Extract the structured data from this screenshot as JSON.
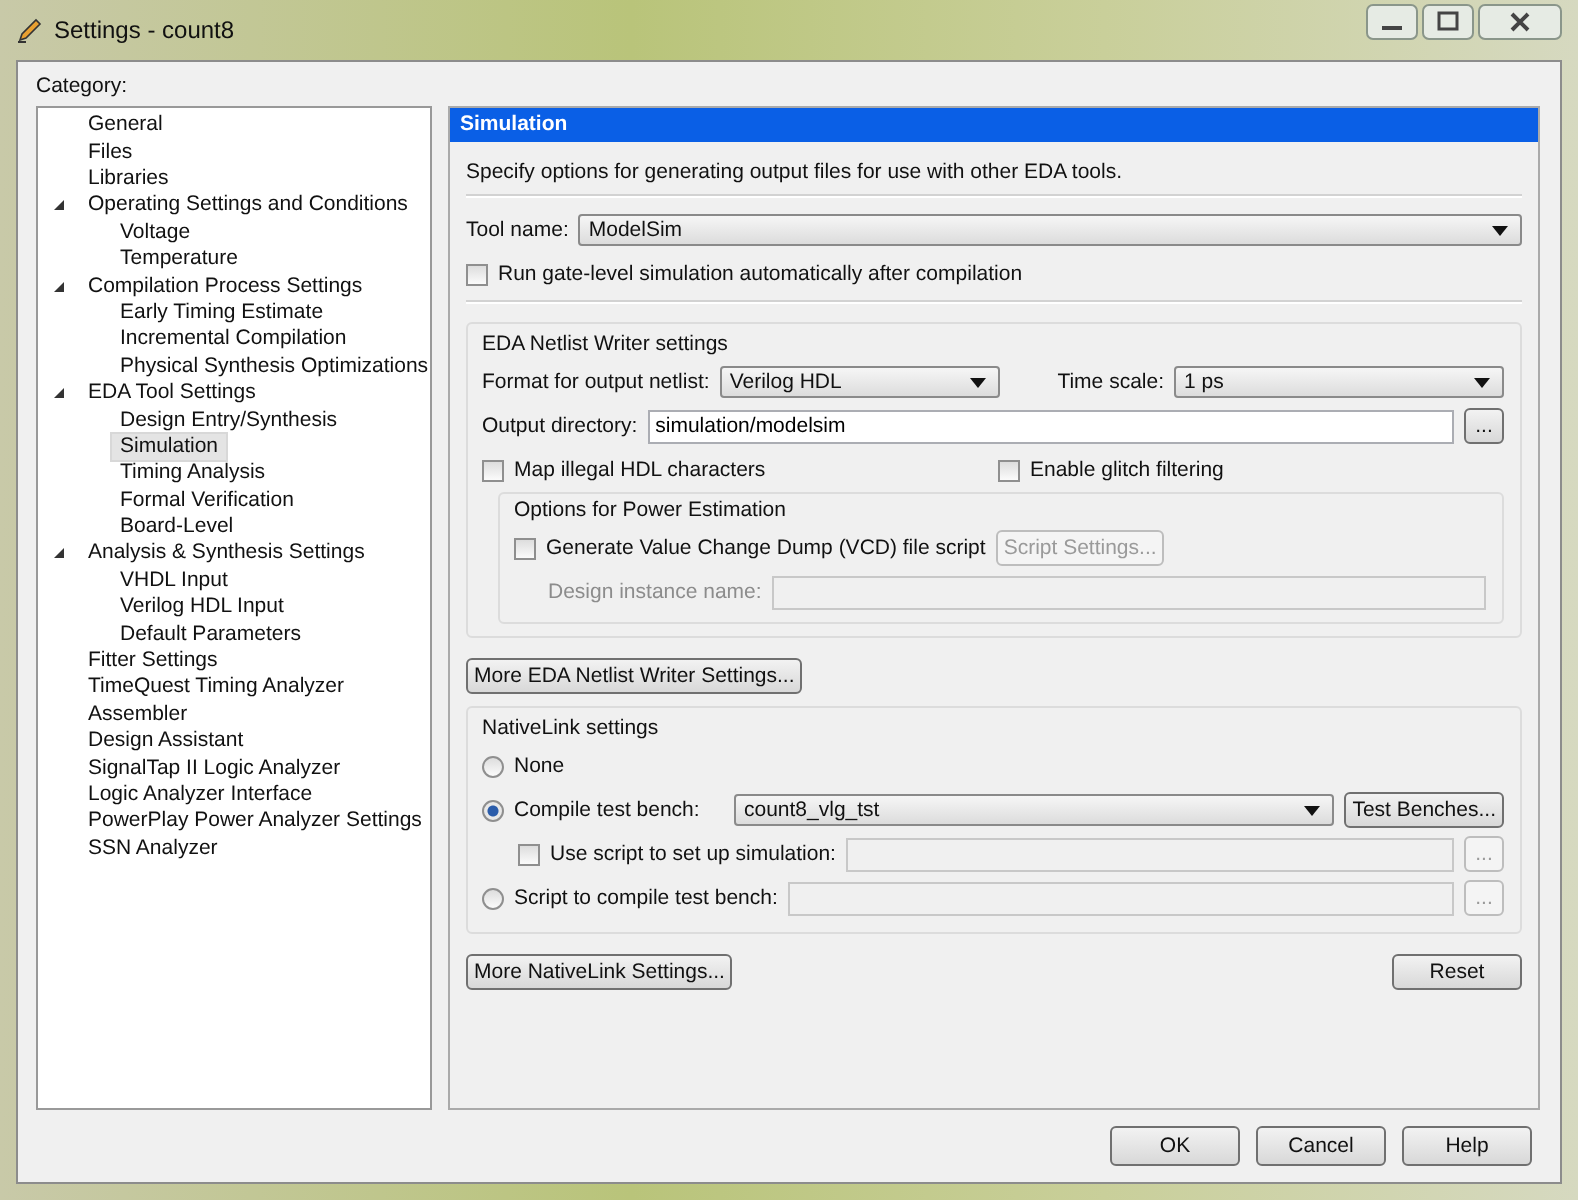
{
  "window": {
    "title": "Settings - count8"
  },
  "category_label": "Category:",
  "tree": [
    {
      "label": "General",
      "selected": false
    },
    {
      "label": "Files",
      "selected": false
    },
    {
      "label": "Libraries",
      "selected": false
    },
    {
      "label": "Operating Settings and Conditions",
      "selected": false,
      "expanded": true,
      "children": [
        {
          "label": "Voltage",
          "selected": false
        },
        {
          "label": "Temperature",
          "selected": false
        }
      ]
    },
    {
      "label": "Compilation Process Settings",
      "selected": false,
      "expanded": true,
      "children": [
        {
          "label": "Early Timing Estimate",
          "selected": false
        },
        {
          "label": "Incremental Compilation",
          "selected": false
        },
        {
          "label": "Physical Synthesis Optimizations",
          "selected": false
        }
      ]
    },
    {
      "label": "EDA Tool Settings",
      "selected": false,
      "expanded": true,
      "children": [
        {
          "label": "Design Entry/Synthesis",
          "selected": false
        },
        {
          "label": "Simulation",
          "selected": true
        },
        {
          "label": "Timing Analysis",
          "selected": false
        },
        {
          "label": "Formal Verification",
          "selected": false
        },
        {
          "label": "Board-Level",
          "selected": false
        }
      ]
    },
    {
      "label": "Analysis & Synthesis Settings",
      "selected": false,
      "expanded": true,
      "children": [
        {
          "label": "VHDL Input",
          "selected": false
        },
        {
          "label": "Verilog HDL Input",
          "selected": false
        },
        {
          "label": "Default Parameters",
          "selected": false
        }
      ]
    },
    {
      "label": "Fitter Settings",
      "selected": false
    },
    {
      "label": "TimeQuest Timing Analyzer",
      "selected": false
    },
    {
      "label": "Assembler",
      "selected": false
    },
    {
      "label": "Design Assistant",
      "selected": false
    },
    {
      "label": "SignalTap II Logic Analyzer",
      "selected": false
    },
    {
      "label": "Logic Analyzer Interface",
      "selected": false
    },
    {
      "label": "PowerPlay Power Analyzer Settings",
      "selected": false
    },
    {
      "label": "SSN Analyzer",
      "selected": false
    }
  ],
  "panel": {
    "title": "Simulation",
    "description": "Specify options for generating output files for use with other EDA tools.",
    "tool_name": {
      "label": "Tool name:",
      "value": "ModelSim"
    },
    "run_gate_level": {
      "label": "Run gate-level simulation automatically after compilation",
      "checked": false
    },
    "netlist": {
      "title": "EDA Netlist Writer settings",
      "format": {
        "label": "Format for output netlist:",
        "value": "Verilog HDL"
      },
      "time_scale": {
        "label": "Time scale:",
        "value": "1 ps"
      },
      "output_directory": {
        "label": "Output directory:",
        "value": "simulation/modelsim",
        "browse": "..."
      },
      "map_illegal": {
        "label": "Map illegal HDL characters",
        "checked": false
      },
      "glitch": {
        "label": "Enable glitch filtering",
        "checked": false
      },
      "power": {
        "title": "Options for Power Estimation",
        "vcd": {
          "label": "Generate Value Change Dump (VCD) file script",
          "checked": false
        },
        "script_settings": {
          "label": "Script Settings...",
          "disabled": true
        },
        "instance": {
          "label": "Design instance name:",
          "disabled": true
        }
      }
    },
    "more_netlist_button": "More EDA Netlist Writer Settings...",
    "nativelink": {
      "title": "NativeLink settings",
      "none": {
        "label": "None",
        "selected": false
      },
      "compile": {
        "label": "Compile test bench:",
        "selected": true,
        "value": "count8_vlg_tst",
        "button": "Test Benches..."
      },
      "use_script": {
        "label": "Use script to set up simulation:",
        "checked": false,
        "disabled": true,
        "browse": "..."
      },
      "script": {
        "label": "Script to compile test bench:",
        "selected": false,
        "disabled": true,
        "browse": "..."
      }
    },
    "more_nativelink_button": "More NativeLink Settings...",
    "reset_button": "Reset"
  },
  "buttons": [
    {
      "label": "OK"
    },
    {
      "label": "Cancel"
    },
    {
      "label": "Help"
    }
  ]
}
